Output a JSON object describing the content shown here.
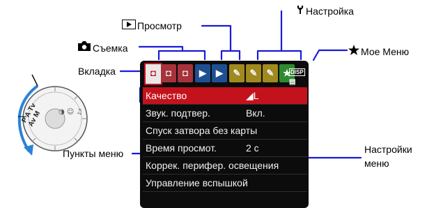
{
  "labels": {
    "setup": "Настройка",
    "playback": "Просмотр",
    "shooting": "Съемка",
    "my_menu": "Мое Меню",
    "tab": "Вкладка",
    "settings_line1": "Настройки",
    "settings_line2": "меню",
    "menu_items": "Пункты меню"
  },
  "menu": {
    "items": [
      {
        "label": "Качество",
        "value": "◢L"
      },
      {
        "label": "Звук. подтвер.",
        "value": "Вкл."
      },
      {
        "label": "Спуск затвора без карты",
        "value": ""
      },
      {
        "label": "Время просмот.",
        "value": "2 с"
      },
      {
        "label": "Коррек. перифер. освещения",
        "value": ""
      },
      {
        "label": "Управление вспышкой",
        "value": ""
      },
      {
        "label": "",
        "value": ""
      }
    ],
    "selected_index": 0
  },
  "tabs": [
    {
      "type": "shoot",
      "glyph": "◘"
    },
    {
      "type": "shoot",
      "glyph": "◘"
    },
    {
      "type": "shoot",
      "glyph": "◘"
    },
    {
      "type": "play",
      "glyph": "▶"
    },
    {
      "type": "play",
      "glyph": "▶"
    },
    {
      "type": "setup",
      "glyph": "✎"
    },
    {
      "type": "setup",
      "glyph": "✎"
    },
    {
      "type": "setup",
      "glyph": "✎"
    },
    {
      "type": "mine",
      "glyph": "★"
    }
  ],
  "screen_extra": {
    "disp_label": "DISP",
    "menu_glyph": "▤"
  },
  "dial": {
    "letters": "P A Tv Av M",
    "icons": "◑ ☺ ♫"
  },
  "colors": {
    "shoot": "#a8323a",
    "play": "#1e4f93",
    "setup": "#a08a1e",
    "mine": "#2f8a2f",
    "highlight": "#c4121d",
    "callout_line": "#1a1ad8",
    "dial_arrow": "#2a82d8"
  },
  "icons": [
    "camera-icon",
    "playback-icon",
    "wrench-icon",
    "star-icon",
    "dial-arrow-icon"
  ]
}
